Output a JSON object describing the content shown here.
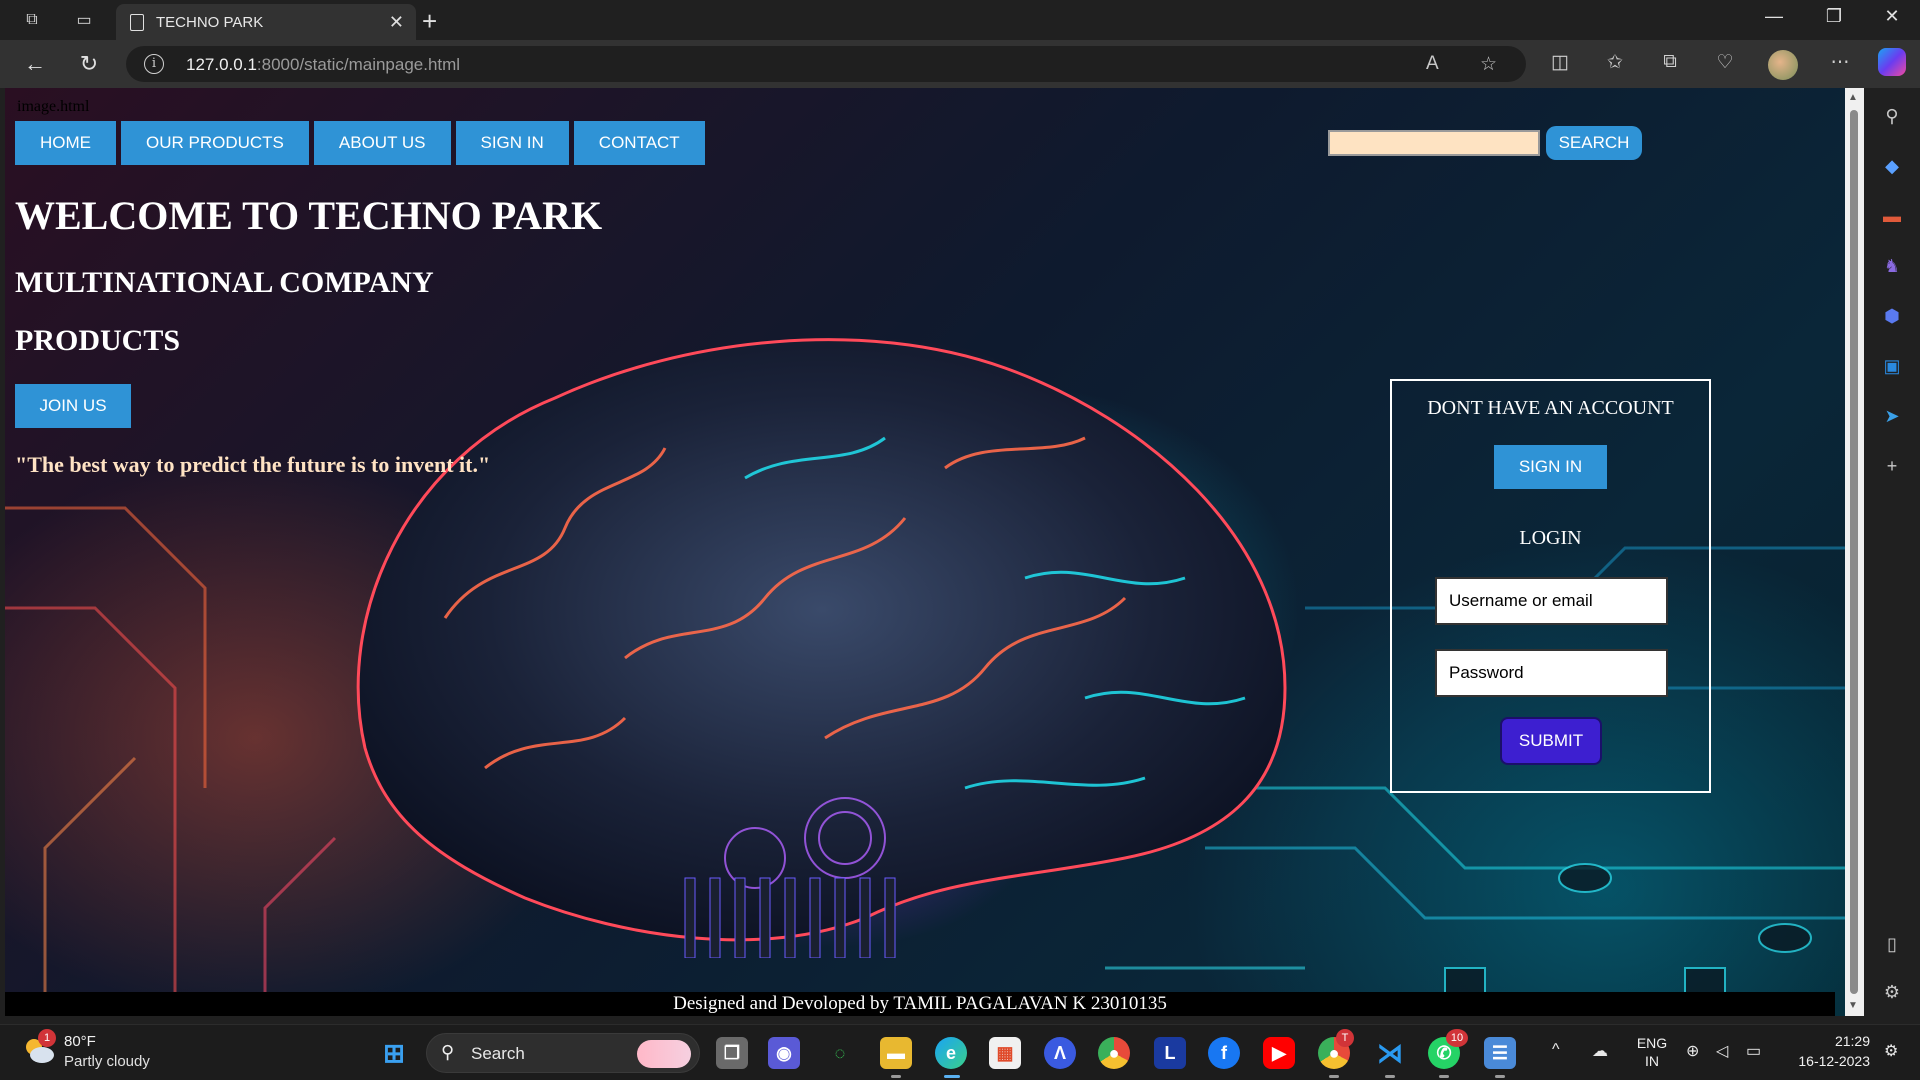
{
  "browser": {
    "tab_title": "TECHNO PARK",
    "url_host": "127.0.0.1",
    "url_rest": ":8000/static/mainpage.html"
  },
  "page": {
    "broken_image_alt": "image.html",
    "nav": [
      "HOME",
      "OUR PRODUCTS",
      "ABOUT US",
      "SIGN IN",
      "CONTACT"
    ],
    "search_button": "SEARCH",
    "search_value": "",
    "heading": "WELCOME TO TECHNO PARK",
    "subheading1": "MULTINATIONAL COMPANY",
    "subheading2": "PRODUCTS",
    "join_button": "JOIN US",
    "quote": "\"The best way to predict the future is to invent it.\"",
    "login_box": {
      "no_account": "DONT HAVE AN ACCOUNT",
      "signin_button": "SIGN IN",
      "login_title": "LOGIN",
      "username": "Username or email",
      "password": "Password",
      "submit": "SUBMIT"
    },
    "footer": "Designed and Devoloped by TAMIL PAGALAVAN K 23010135"
  },
  "taskbar": {
    "weather_temp": "80°F",
    "weather_desc": "Partly cloudy",
    "weather_badge": "1",
    "search_label": "Search",
    "chrome_badge": "T",
    "whatsapp_badge": "10",
    "lang_top": "ENG",
    "lang_bottom": "IN",
    "time": "21:29",
    "date": "16-12-2023"
  },
  "colors": {
    "nav_blue": "#2f93d6",
    "submit_purple": "#3d1fd0",
    "search_field": "#fee3c2",
    "quote_text": "#ffe3c4"
  }
}
